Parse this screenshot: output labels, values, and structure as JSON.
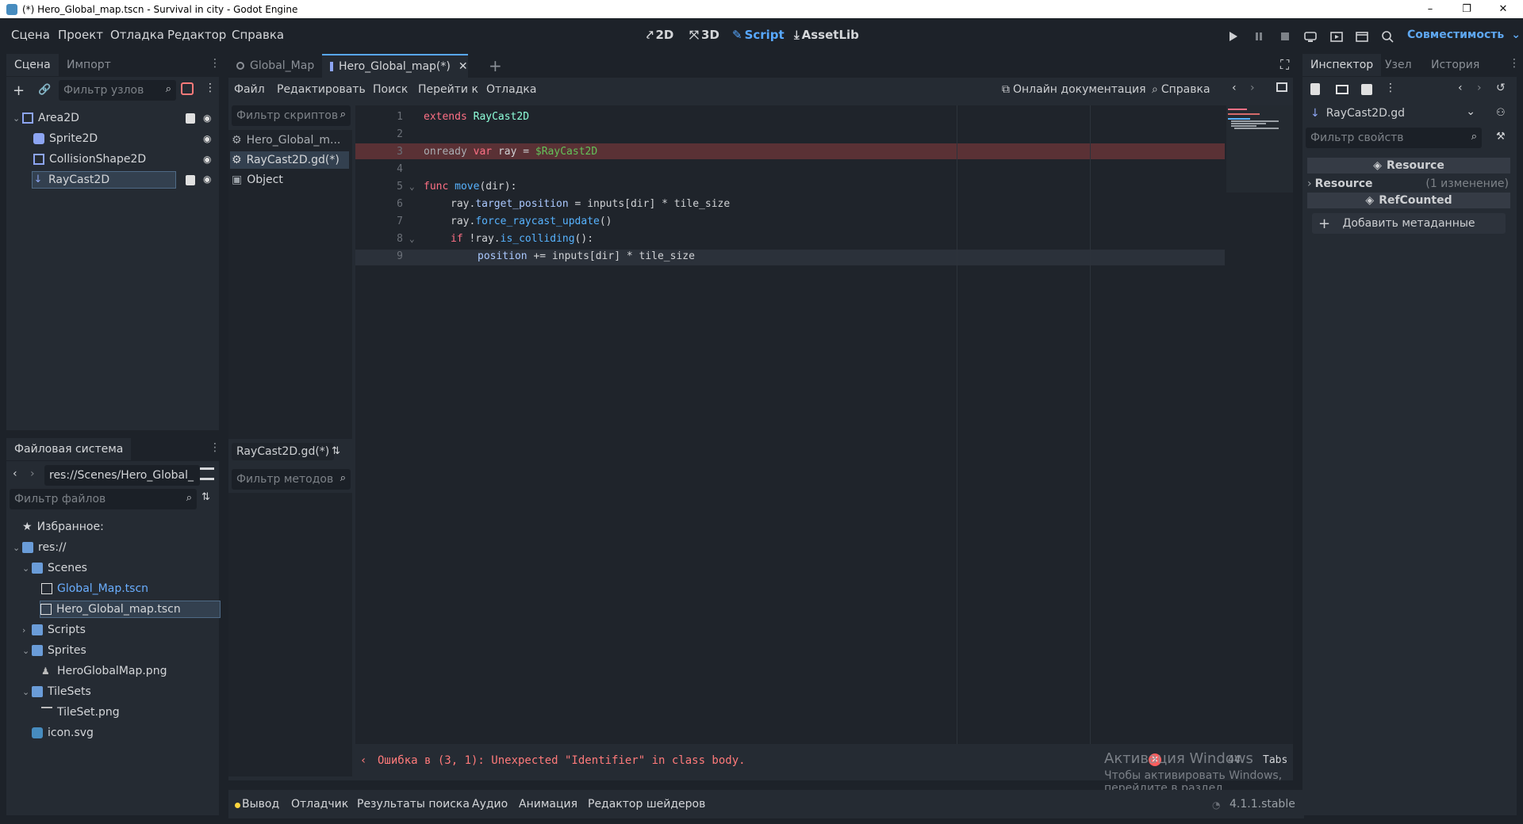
{
  "window": {
    "title": "(*) Hero_Global_map.tscn - Survival in city - Godot Engine",
    "controls": [
      "–",
      "❐",
      "✕"
    ]
  },
  "menu": [
    "Сцена",
    "Проект",
    "Отладка",
    "Редактор",
    "Справка"
  ],
  "modes": [
    {
      "label": "2D",
      "icon": "2d-icon"
    },
    {
      "label": "3D",
      "icon": "3d-icon"
    },
    {
      "label": "Script",
      "icon": "script-icon",
      "active": true
    },
    {
      "label": "AssetLib",
      "icon": "assetlib-icon"
    }
  ],
  "renderer": "Совместимость",
  "scene_dock": {
    "tabs": [
      "Сцена",
      "Импорт"
    ],
    "filter_placeholder": "Фильтр узлов",
    "nodes": [
      {
        "name": "Area2D",
        "icon": "area2d-icon",
        "color": "#8da5f3"
      },
      {
        "name": "Sprite2D",
        "icon": "sprite2d-icon",
        "color": "#8da5f3"
      },
      {
        "name": "CollisionShape2D",
        "icon": "collisionshape2d-icon",
        "color": "#8da5f3"
      },
      {
        "name": "RayCast2D",
        "icon": "raycast2d-icon",
        "color": "#8da5f3",
        "selected": true
      }
    ]
  },
  "filesystem": {
    "title": "Файловая система",
    "path": "res://Scenes/Hero_Global_",
    "filter_placeholder": "Фильтр файлов",
    "items": [
      {
        "label": "Избранное:",
        "icon": "star-icon"
      },
      {
        "label": "res://",
        "icon": "folder-icon"
      },
      {
        "label": "Scenes",
        "icon": "folder-icon"
      },
      {
        "label": "Global_Map.tscn",
        "icon": "scene-file-icon"
      },
      {
        "label": "Hero_Global_map.tscn",
        "icon": "scene-file-icon",
        "selected": true
      },
      {
        "label": "Scripts",
        "icon": "folder-icon"
      },
      {
        "label": "Sprites",
        "icon": "folder-icon"
      },
      {
        "label": "HeroGlobalMap.png",
        "icon": "image-file-icon"
      },
      {
        "label": "TileSets",
        "icon": "folder-icon"
      },
      {
        "label": "TileSet.png",
        "icon": "image-file-icon"
      },
      {
        "label": "icon.svg",
        "icon": "svg-file-icon"
      }
    ]
  },
  "editor_tabs": [
    {
      "label": "Global_Map",
      "active": false
    },
    {
      "label": "Hero_Global_map(*)",
      "active": true
    }
  ],
  "script_menu": [
    "Файл",
    "Редактировать",
    "Поиск",
    "Перейти к",
    "Отладка"
  ],
  "script_links": {
    "docs": "Онлайн документация",
    "help": "Справка"
  },
  "script_list": {
    "filter_placeholder": "Фильтр скриптов",
    "items": [
      {
        "label": "Hero_Global_m...",
        "icon": "gear-icon"
      },
      {
        "label": "RayCast2D.gd(*)",
        "icon": "gear-icon",
        "selected": true
      },
      {
        "label": "Object",
        "icon": "class-icon"
      }
    ],
    "current": "RayCast2D.gd(*)",
    "methods_placeholder": "Фильтр методов"
  },
  "code": {
    "lines": [
      "1",
      "2",
      "3",
      "4",
      "5",
      "6",
      "7",
      "8",
      "9"
    ],
    "l1": {
      "kw": "extends",
      "ty": "RayCast2D"
    },
    "l3": {
      "kw": "onready",
      "kw2": "var",
      "name": "ray",
      "op": "=",
      "node": "$RayCast2D"
    },
    "l5": {
      "kw": "func",
      "fn": "move",
      "args": "(dir):"
    },
    "l6": {
      "a": "ray.",
      "b": "target_position",
      "c": " = inputs[dir] * tile_size"
    },
    "l7": {
      "a": "ray.",
      "fn": "force_raycast_update",
      "c": "()"
    },
    "l8": {
      "kw": "if",
      "a": " !ray.",
      "fn": "is_colliding",
      "c": "():"
    },
    "l9": {
      "a": "position",
      "c": " += inputs[dir] * tile_size"
    }
  },
  "status": {
    "error": "Ошибка в (3, 1): Unexpected \"Identifier\" in class body.",
    "cursor": "44",
    "indent": "Tabs",
    "watermark1": "Активация Windows",
    "watermark2": "Чтобы активировать Windows, перейдите в раздел \"Параметры\"."
  },
  "bottom_tabs": [
    "Вывод",
    "Отладчик",
    "Результаты поиска",
    "Аудио",
    "Анимация",
    "Редактор шейдеров"
  ],
  "version": "4.1.1.stable",
  "inspector": {
    "tabs": [
      "Инспектор",
      "Узел",
      "История"
    ],
    "resource": "RayCast2D.gd",
    "filter_placeholder": "Фильтр свойств",
    "section1": "Resource",
    "row_label": "Resource",
    "row_value": "(1 изменение)",
    "section2": "RefCounted",
    "add_meta": "Добавить метаданные"
  },
  "colors": {
    "accent": "#58a8ff",
    "error": "#ff7a7a",
    "error_line": "#5a3135"
  }
}
